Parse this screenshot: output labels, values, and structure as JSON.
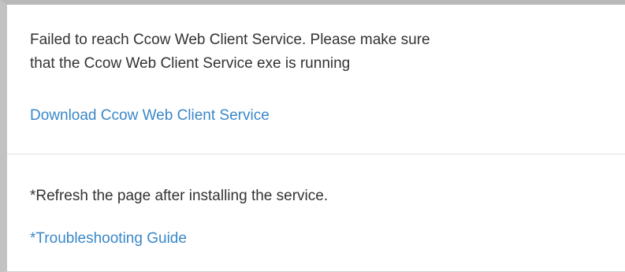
{
  "error_panel": {
    "message_line1": "Failed to reach Ccow Web Client Service. Please make sure",
    "message_line2": "that the Ccow Web Client Service exe is running",
    "download_link": "Download Ccow Web Client Service"
  },
  "help_panel": {
    "refresh_note": "*Refresh the page after installing the service.",
    "troubleshooting_link": "*Troubleshooting Guide"
  },
  "colors": {
    "link": "#3a87c8",
    "text": "#333333",
    "border": "#c2c2c2"
  }
}
